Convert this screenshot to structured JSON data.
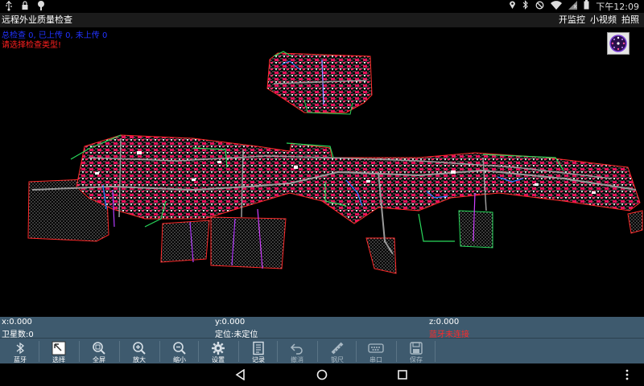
{
  "status": {
    "left_icons": [
      "usb-icon",
      "lock-icon",
      "download-icon"
    ],
    "right_icons": [
      "location-icon",
      "bluetooth-icon",
      "block-icon",
      "wifi-icon",
      "no-sim-icon",
      "battery-icon"
    ],
    "time": "下午12:09"
  },
  "titlebar": {
    "title": "远程外业质量检查",
    "actions": [
      "开监控",
      "小视频",
      "拍照"
    ]
  },
  "map": {
    "info_line": "总检查 0, 已上传 0, 未上传 0",
    "prompt": "请选择检查类型!",
    "compass_icon": "compass-icon"
  },
  "coords": {
    "x": "x:0.000",
    "y": "y:0.000",
    "z": "z:0.000",
    "satellites": "卫星数:0",
    "location": "定位:未定位",
    "warning": "蓝牙未连接"
  },
  "toolbar": [
    {
      "label": "蓝牙",
      "icon": "bluetooth-icon"
    },
    {
      "label": "选择",
      "icon": "select-icon"
    },
    {
      "label": "全屏",
      "icon": "zoom-extent-icon"
    },
    {
      "label": "放大",
      "icon": "zoom-in-icon"
    },
    {
      "label": "缩小",
      "icon": "zoom-out-icon"
    },
    {
      "label": "设置",
      "icon": "gear-icon"
    },
    {
      "label": "记录",
      "icon": "record-icon"
    },
    {
      "label": "撤消",
      "icon": "undo-icon"
    },
    {
      "label": "钢尺",
      "icon": "ruler-icon"
    },
    {
      "label": "串口",
      "icon": "serial-port-icon"
    },
    {
      "label": "保存",
      "icon": "save-icon"
    }
  ],
  "colors": {
    "info_text": "#2233ff",
    "prompt_text": "#ff2020",
    "panel_bg": "#3e5a6e",
    "map_bg": "#000000"
  }
}
